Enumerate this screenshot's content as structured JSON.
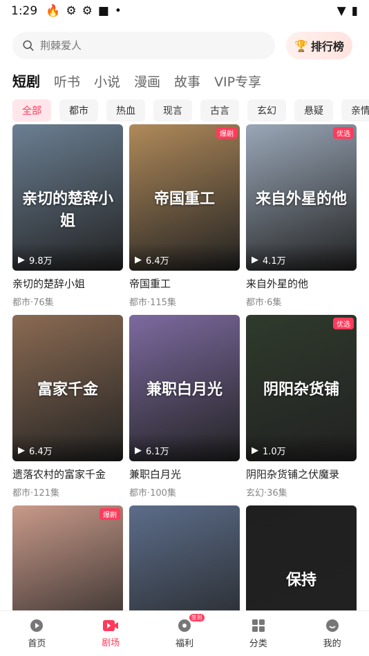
{
  "status_bar": {
    "time": "1:29"
  },
  "search": {
    "placeholder": "荆棘爱人"
  },
  "rank_button": {
    "label": "排行榜"
  },
  "category_tabs": [
    "短剧",
    "听书",
    "小说",
    "漫画",
    "故事",
    "VIP专享"
  ],
  "filter_chips": [
    "全部",
    "都市",
    "热血",
    "现言",
    "古言",
    "玄幻",
    "悬疑",
    "亲情"
  ],
  "cards": [
    {
      "title": "亲切的楚辞小姐",
      "meta": "都市·76集",
      "plays": "9.8万",
      "badge": "",
      "poster_text": "亲切的楚辞小姐",
      "color": "#6b7f93"
    },
    {
      "title": "帝国重工",
      "meta": "都市·115集",
      "plays": "6.4万",
      "badge": "爆剧",
      "poster_text": "帝国重工",
      "color": "#b08a5a"
    },
    {
      "title": "来自外星的他",
      "meta": "都市·6集",
      "plays": "4.1万",
      "badge": "优选",
      "poster_text": "来自外星的他",
      "color": "#9aa7b8"
    },
    {
      "title": "遗落农村的富家千金",
      "meta": "都市·121集",
      "plays": "6.4万",
      "badge": "",
      "poster_text": "富家千金",
      "color": "#8b6b53"
    },
    {
      "title": "兼职白月光",
      "meta": "都市·100集",
      "plays": "6.1万",
      "badge": "",
      "poster_text": "兼职白月光",
      "color": "#7d6aa0"
    },
    {
      "title": "阴阳杂货铺之伏魔录",
      "meta": "玄幻·36集",
      "plays": "1.0万",
      "badge": "优选",
      "poster_text": "阴阳杂货铺",
      "color": "#2f3a2c"
    },
    {
      "title": "",
      "meta": "",
      "plays": "",
      "badge": "爆剧",
      "poster_text": "",
      "color": "#c99a8a"
    },
    {
      "title": "",
      "meta": "",
      "plays": "",
      "badge": "",
      "poster_text": "",
      "color": "#5c6d8a"
    },
    {
      "title": "",
      "meta": "",
      "plays": "",
      "badge": "",
      "poster_text": "保持",
      "color": "#1f1f1f"
    }
  ],
  "bottom_nav": [
    {
      "label": "首页",
      "icon": "home-icon"
    },
    {
      "label": "剧场",
      "icon": "theater-icon"
    },
    {
      "label": "福利",
      "icon": "gift-icon",
      "badge": "签到"
    },
    {
      "label": "分类",
      "icon": "category-icon"
    },
    {
      "label": "我的",
      "icon": "profile-icon"
    }
  ],
  "accent_color": "#ff3b5c"
}
